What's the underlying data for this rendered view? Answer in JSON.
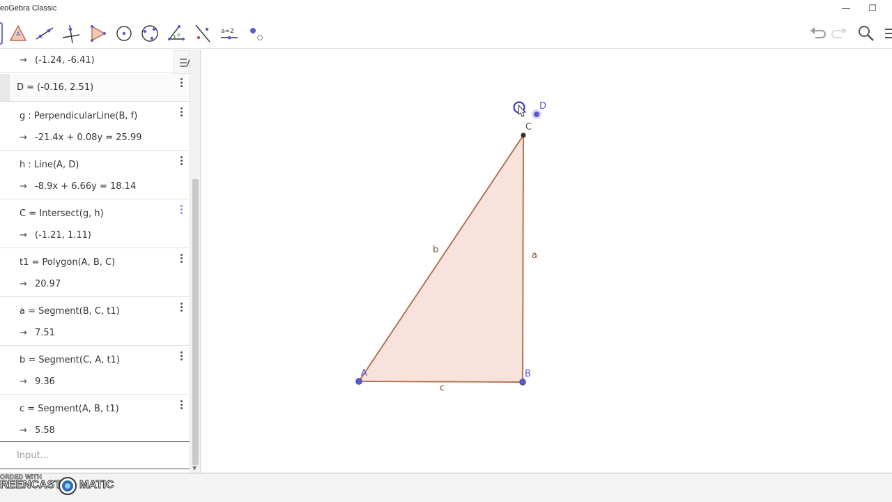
{
  "window": {
    "title": "eoGebra Classic",
    "minimize_glyph": "—",
    "maximize_glyph": "☐"
  },
  "toolbar": {
    "tools": [
      {
        "name": "move-tool",
        "icon": "arrow-icon"
      },
      {
        "name": "point-tool",
        "icon": "point-on-object-icon"
      },
      {
        "name": "line-tool",
        "icon": "line-icon"
      },
      {
        "name": "perpendicular-line-tool",
        "icon": "perpendicular-icon"
      },
      {
        "name": "polygon-tool",
        "icon": "polygon-icon"
      },
      {
        "name": "circle-tool",
        "icon": "circle-center-point-icon"
      },
      {
        "name": "ellipse-tool",
        "icon": "ellipse-icon"
      },
      {
        "name": "angle-tool",
        "icon": "angle-icon"
      },
      {
        "name": "reflect-tool",
        "icon": "reflect-line-icon"
      },
      {
        "name": "slider-tool",
        "icon": "slider-icon",
        "label": "a=2"
      },
      {
        "name": "move-graphics-tool",
        "icon": "move-graphics-icon"
      }
    ],
    "right": [
      "undo-icon",
      "redo-icon",
      "search-icon",
      "menu-icon"
    ]
  },
  "algebra": {
    "input_placeholder": "Input...",
    "arrow": "→",
    "rows": [
      {
        "definition": "",
        "value": "(-1.24, -6.41)"
      },
      {
        "definition": "D = (-0.16, 2.51)",
        "value": ""
      },
      {
        "definition": "g : PerpendicularLine(B, f)",
        "value": "-21.4x + 0.08y = 25.99"
      },
      {
        "definition": "h : Line(A, D)",
        "value": "-8.9x + 6.66y = 18.14"
      },
      {
        "definition": "C = Intersect(g, h)",
        "value": "(-1.21, 1.11)"
      },
      {
        "definition": "t1 = Polygon(A, B, C)",
        "value": "20.97"
      },
      {
        "definition": "a = Segment(B, C, t1)",
        "value": "7.51"
      },
      {
        "definition": "b = Segment(C, A, t1)",
        "value": "9.36"
      },
      {
        "definition": "c = Segment(A, B, t1)",
        "value": "5.58"
      }
    ]
  },
  "graphics": {
    "points": {
      "A": "A",
      "B": "B",
      "C": "C",
      "D": "D"
    },
    "segments": {
      "a": "a",
      "b": "b",
      "c": "c"
    },
    "colors": {
      "polygon_fill": "#f7e3dc",
      "polygon_stroke": "#b56a4a",
      "label": "#8a4a2e",
      "point_blue": "#5a5ad6",
      "point_black": "#333333"
    }
  },
  "watermark": {
    "line1": "ORDED WITH",
    "left": "REENCAST",
    "right": "MATIC"
  }
}
